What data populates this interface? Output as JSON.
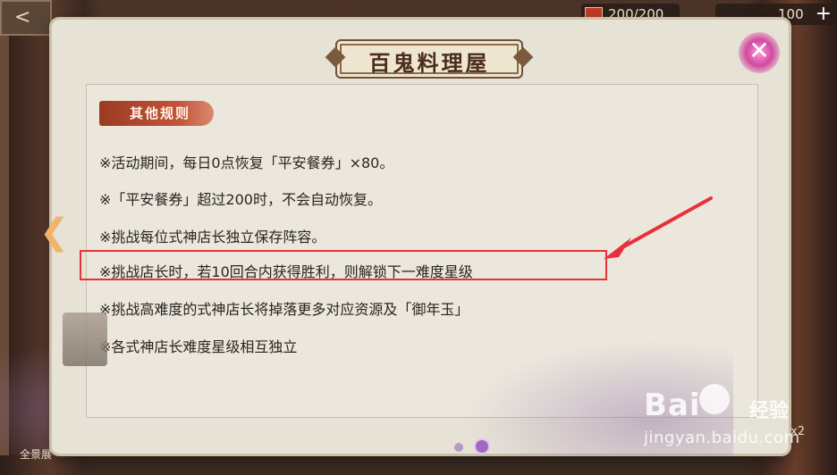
{
  "hud": {
    "back_label": "<",
    "stamina": "200/200",
    "coins": "100",
    "plus_label": "+",
    "bottom_left_label": "全景展",
    "bottom_right_label": "x2"
  },
  "dialog": {
    "title": "百鬼料理屋",
    "close_label": "✕",
    "section_label": "其他规则",
    "rules": [
      "※活动期间，每日0点恢复「平安餐券」×80。",
      "※「平安餐券」超过200时，不会自动恢复。",
      "※挑战每位式神店长独立保存阵容。",
      "※挑战店长时，若10回合内获得胜利，则解锁下一难度星级",
      "※挑战高难度的式神店长将掉落更多对应资源及「御年玉」",
      "※各式神店长难度星级相互独立"
    ],
    "prev_arrow": "❮",
    "pager": {
      "total": 2,
      "current": 2
    }
  },
  "watermark": {
    "brand": "Bai",
    "brand2": "经验",
    "url": "jingyan.baidu.com"
  },
  "colors": {
    "highlight": "#e8303a",
    "section_tab": "#b2462d",
    "dialog_bg": "#e7e2d6"
  }
}
